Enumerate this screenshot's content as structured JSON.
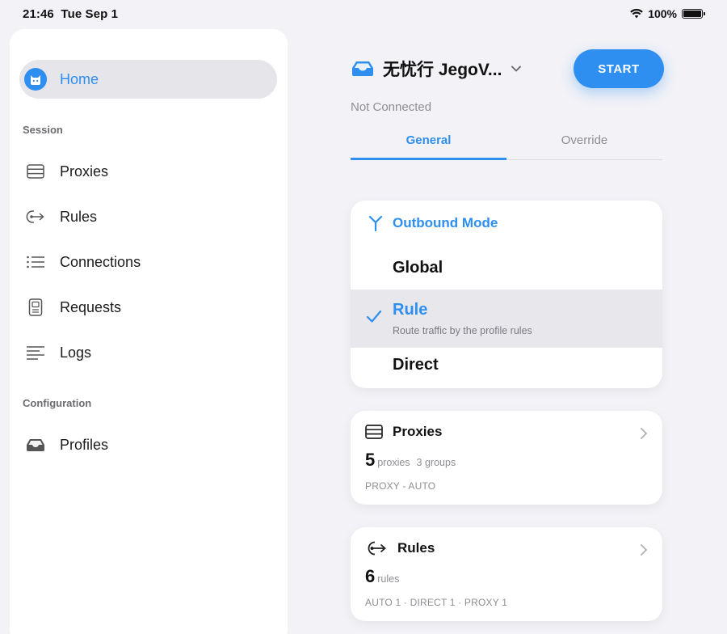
{
  "status_bar": {
    "time": "21:46",
    "date": "Tue Sep 1",
    "battery": "100%"
  },
  "sidebar": {
    "home_label": "Home",
    "session_title": "Session",
    "session_items": [
      {
        "label": "Proxies",
        "icon": "server-list-icon"
      },
      {
        "label": "Rules",
        "icon": "rule-arrow-icon"
      },
      {
        "label": "Connections",
        "icon": "list-icon"
      },
      {
        "label": "Requests",
        "icon": "document-icon"
      },
      {
        "label": "Logs",
        "icon": "lines-icon"
      }
    ],
    "configuration_title": "Configuration",
    "configuration_items": [
      {
        "label": "Profiles",
        "icon": "tray-icon"
      }
    ]
  },
  "header": {
    "profile_name": "无忧行 JegoV...",
    "start_label": "START",
    "connection_status": "Not Connected"
  },
  "tabs": [
    {
      "label": "General",
      "selected": true
    },
    {
      "label": "Override",
      "selected": false
    }
  ],
  "outbound": {
    "title": "Outbound Mode",
    "modes": [
      {
        "label": "Global",
        "selected": false
      },
      {
        "label": "Rule",
        "selected": true,
        "description": "Route traffic by the profile rules"
      },
      {
        "label": "Direct",
        "selected": false
      }
    ]
  },
  "proxies_card": {
    "title": "Proxies",
    "count": "5",
    "count_unit": "proxies",
    "groups": "3 groups",
    "detail": "PROXY - AUTO"
  },
  "rules_card": {
    "title": "Rules",
    "count": "6",
    "count_unit": "rules",
    "detail": "AUTO 1 · DIRECT 1 · PROXY 1"
  },
  "colors": {
    "accent": "#2e8ff0",
    "background": "#f2f2f7",
    "card": "#ffffff"
  }
}
